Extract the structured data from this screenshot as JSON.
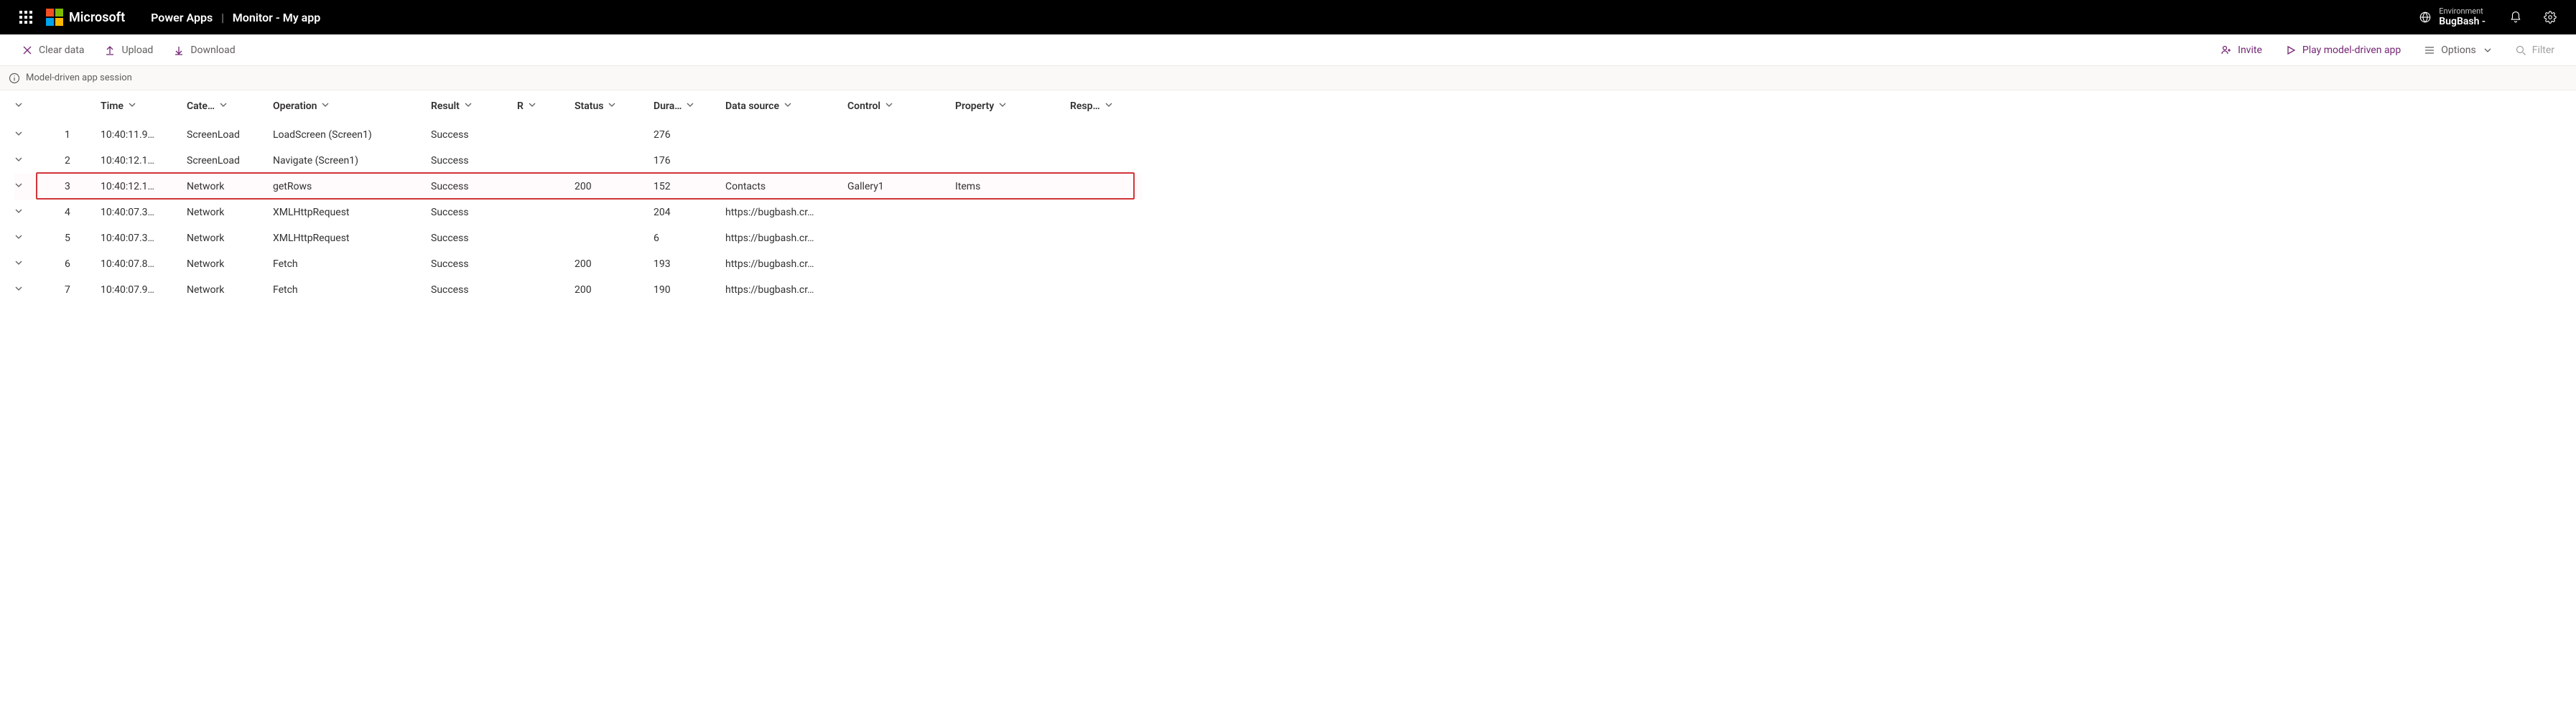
{
  "top": {
    "wordmark": "Microsoft",
    "app_name": "Power Apps",
    "page_title": "Monitor - My app",
    "env_label": "Environment",
    "env_name": "BugBash -"
  },
  "cmd": {
    "clear": "Clear data",
    "upload": "Upload",
    "download": "Download",
    "invite": "Invite",
    "play": "Play model-driven app",
    "options": "Options",
    "filter": "Filter"
  },
  "session": {
    "text": "Model-driven app session"
  },
  "grid": {
    "headers": {
      "time": "Time",
      "category": "Cate…",
      "operation": "Operation",
      "result": "Result",
      "r": "R",
      "status": "Status",
      "duration": "Dura…",
      "datasource": "Data source",
      "control": "Control",
      "property": "Property",
      "response": "Resp…"
    },
    "rows": [
      {
        "idx": "1",
        "time": "10:40:11.9…",
        "category": "ScreenLoad",
        "operation": "LoadScreen (Screen1)",
        "result": "Success",
        "status": "",
        "duration": "276",
        "datasource": "",
        "control": "",
        "property": "",
        "highlight": false
      },
      {
        "idx": "2",
        "time": "10:40:12.1…",
        "category": "ScreenLoad",
        "operation": "Navigate (Screen1)",
        "result": "Success",
        "status": "",
        "duration": "176",
        "datasource": "",
        "control": "",
        "property": "",
        "highlight": false
      },
      {
        "idx": "3",
        "time": "10:40:12.1…",
        "category": "Network",
        "operation": "getRows",
        "result": "Success",
        "status": "200",
        "duration": "152",
        "datasource": "Contacts",
        "control": "Gallery1",
        "property": "Items",
        "highlight": true
      },
      {
        "idx": "4",
        "time": "10:40:07.3…",
        "category": "Network",
        "operation": "XMLHttpRequest",
        "result": "Success",
        "status": "",
        "duration": "204",
        "datasource": "https://bugbash.cr…",
        "control": "",
        "property": "",
        "highlight": false
      },
      {
        "idx": "5",
        "time": "10:40:07.3…",
        "category": "Network",
        "operation": "XMLHttpRequest",
        "result": "Success",
        "status": "",
        "duration": "6",
        "datasource": "https://bugbash.cr…",
        "control": "",
        "property": "",
        "highlight": false
      },
      {
        "idx": "6",
        "time": "10:40:07.8…",
        "category": "Network",
        "operation": "Fetch",
        "result": "Success",
        "status": "200",
        "duration": "193",
        "datasource": "https://bugbash.cr…",
        "control": "",
        "property": "",
        "highlight": false
      },
      {
        "idx": "7",
        "time": "10:40:07.9…",
        "category": "Network",
        "operation": "Fetch",
        "result": "Success",
        "status": "200",
        "duration": "190",
        "datasource": "https://bugbash.cr…",
        "control": "",
        "property": "",
        "highlight": false
      }
    ]
  }
}
